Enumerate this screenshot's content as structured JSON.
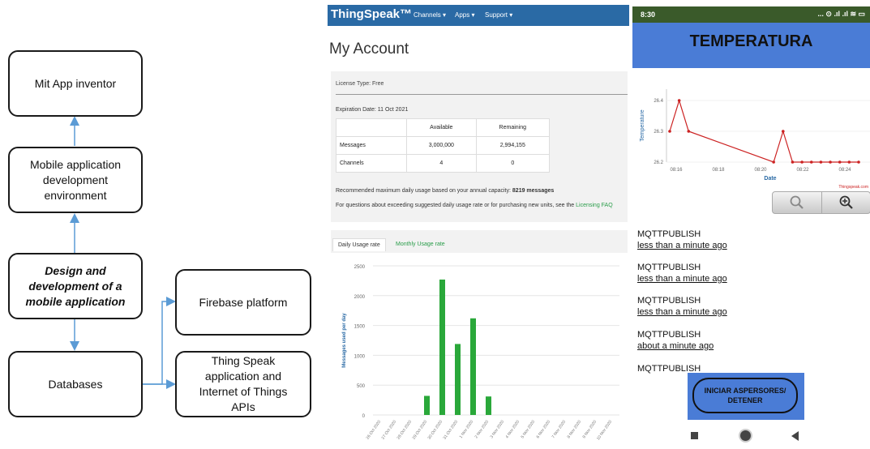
{
  "diagram": {
    "boxes": {
      "mit": "Mit App inventor",
      "mobile": "Mobile application development environment",
      "design": "Design and development of a mobile application",
      "firebase": "Firebase platform",
      "databases": "Databases",
      "thingspeak": "Thing Speak application and Internet of Things APIs"
    }
  },
  "thingspeak": {
    "logo": "ThingSpeak™",
    "menu": [
      "Channels ▾",
      "Apps ▾",
      "Support ▾"
    ],
    "page_title": "My Account",
    "license": "License Type: Free",
    "expiration": "Expiration Date: 11 Oct 2021",
    "table": {
      "headers": [
        "",
        "Available",
        "Remaining"
      ],
      "rows": [
        [
          "Messages",
          "3,000,000",
          "2,994,155"
        ],
        [
          "Channels",
          "4",
          "0"
        ]
      ]
    },
    "recommended": "Recommended maximum daily usage based on your annual capacity:",
    "recommended_value": "8219 messages",
    "faq_text": "For questions about exceeding suggested daily usage rate or for purchasing new units, see the",
    "faq_link": "Licensing FAQ",
    "tabs": [
      "Daily Usage rate",
      "Monthly Usage rate"
    ],
    "accent": "#2a6aa5",
    "bar_color": "#2aa83a"
  },
  "chart_data": {
    "type": "bar",
    "ylabel": "Messages used per day",
    "ylim": [
      0,
      2500
    ],
    "yticks": [
      "2500",
      "2000",
      "1500",
      "1000",
      "500",
      "0"
    ],
    "categories": [
      "26 Oct 2020",
      "27 Oct 2020",
      "28 Oct 2020",
      "29 Oct 2020",
      "30 Oct 2020",
      "31 Oct 2020",
      "1 Nov 2020",
      "2 Nov 2020",
      "3 Nov 2020",
      "4 Nov 2020",
      "5 Nov 2020",
      "6 Nov 2020",
      "7 Nov 2020",
      "8 Nov 2020",
      "9 Nov 2020",
      "10 Nov 2020"
    ],
    "values": [
      0,
      0,
      0,
      320,
      2270,
      1190,
      1620,
      310,
      0,
      0,
      0,
      0,
      0,
      0,
      0,
      0
    ]
  },
  "phone_chart": {
    "type": "line",
    "xlabel": "Date",
    "ylabel": "Temperature",
    "yticks": [
      "26.4",
      "26.3",
      "26.2"
    ],
    "xticks": [
      "08:16",
      "08:18",
      "08:20",
      "08:22",
      "08:24"
    ],
    "credit": "Thingspeak.com",
    "points": [
      [
        8.25,
        26.3
      ],
      [
        8.26,
        26.4
      ],
      [
        8.27,
        26.3
      ],
      [
        8.36,
        26.2
      ],
      [
        8.37,
        26.3
      ],
      [
        8.38,
        26.2
      ],
      [
        8.39,
        26.2
      ],
      [
        8.4,
        26.2
      ],
      [
        8.41,
        26.2
      ],
      [
        8.42,
        26.2
      ],
      [
        8.43,
        26.2
      ],
      [
        8.44,
        26.2
      ],
      [
        8.45,
        26.2
      ]
    ],
    "line_color": "#cc2222"
  },
  "phone": {
    "time": "8:30",
    "status_icons": "... ⊙ .ıl .ıl ≋ ▭",
    "title": "TEMPERATURA",
    "messages": [
      {
        "topic": "MQTTPUBLISH",
        "time": "less than a minute ago"
      },
      {
        "topic": "MQTTPUBLISH",
        "time": "less than a minute ago"
      },
      {
        "topic": "MQTTPUBLISH",
        "time": "less than a minute ago"
      },
      {
        "topic": "MQTTPUBLISH",
        "time": "about a minute ago"
      },
      {
        "topic": "MQTTPUBLISH",
        "time": ""
      }
    ],
    "button": "INICIAR ASPERSORES/ DETENER",
    "header_color": "#4a7cd6"
  }
}
